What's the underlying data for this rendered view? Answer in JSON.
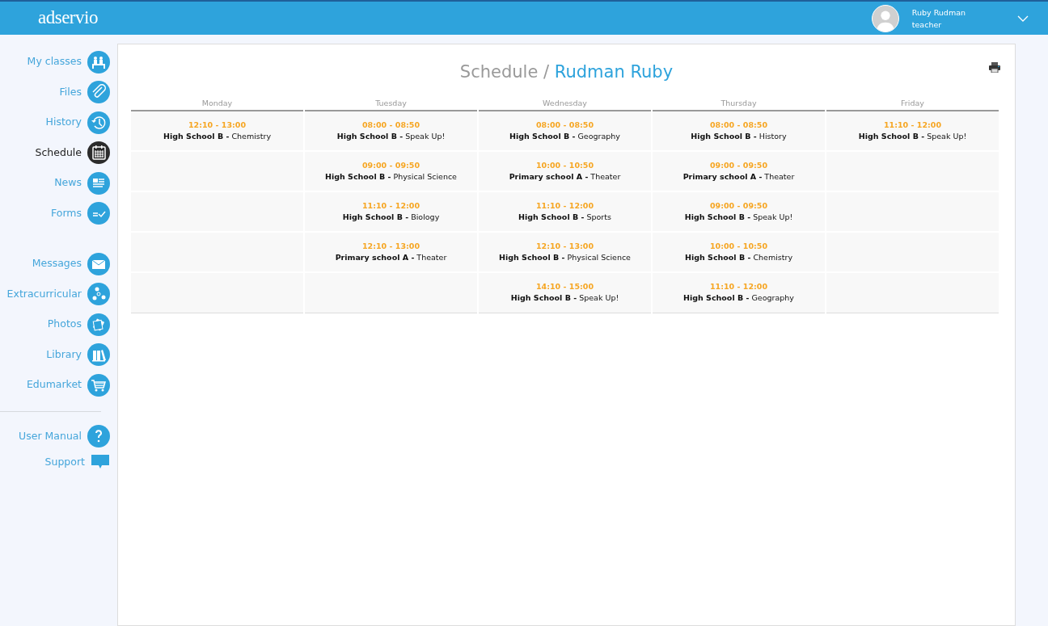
{
  "header": {
    "logo": "adservio",
    "user": {
      "name": "Ruby Rudman",
      "role": "teacher"
    }
  },
  "sidebar": {
    "groups": [
      [
        {
          "label": "My classes",
          "kind": "classes",
          "selected": false
        },
        {
          "label": "Files",
          "kind": "files",
          "selected": false
        },
        {
          "label": "History",
          "kind": "history",
          "selected": false
        },
        {
          "label": "Schedule",
          "kind": "schedule",
          "selected": true
        },
        {
          "label": "News",
          "kind": "news",
          "selected": false
        },
        {
          "label": "Forms",
          "kind": "forms",
          "selected": false
        }
      ],
      [
        {
          "label": "Messages",
          "kind": "messages",
          "selected": false
        },
        {
          "label": "Extracurricular",
          "kind": "extracurricular",
          "selected": false
        },
        {
          "label": "Photos",
          "kind": "photos",
          "selected": false
        },
        {
          "label": "Library",
          "kind": "library",
          "selected": false
        },
        {
          "label": "Edumarket",
          "kind": "market",
          "selected": false
        }
      ],
      [
        {
          "label": "User Manual",
          "kind": "manual",
          "selected": false
        },
        {
          "label": "Support",
          "kind": "support",
          "selected": false
        }
      ]
    ]
  },
  "page": {
    "title": "Schedule / ",
    "subtitle": "Rudman Ruby"
  },
  "schedule": {
    "days": [
      "Monday",
      "Tuesday",
      "Wednesday",
      "Thursday",
      "Friday"
    ],
    "rows": [
      [
        {
          "time": "12:10 - 13:00",
          "text": "**High School B -** Chemistry"
        },
        {
          "time": "08:00 - 08:50",
          "text": "**High School B -** Speak Up!"
        },
        {
          "time": "08:00 - 08:50",
          "text": "**High School B -** Geography"
        },
        {
          "time": "08:00 - 08:50",
          "text": "**High School B -** History"
        },
        {
          "time": "11:10 - 12:00",
          "text": "**High School B -** Speak Up!"
        }
      ],
      [
        null,
        {
          "time": "09:00 - 09:50",
          "text": "**High School B -** Physical Science"
        },
        {
          "time": "10:00 - 10:50",
          "text": "**Primary school A -** Theater"
        },
        {
          "time": "09:00 - 09:50",
          "text": "**Primary school A -** Theater"
        },
        null
      ],
      [
        null,
        {
          "time": "11:10 - 12:00",
          "text": "**High School B -** Biology"
        },
        {
          "time": "11:10 - 12:00",
          "text": "**High School B -** Sports"
        },
        {
          "time": "09:00 - 09:50",
          "text": "**High School B -** Speak Up!"
        },
        null
      ],
      [
        null,
        {
          "time": "12:10 - 13:00",
          "text": "**Primary school A -** Theater"
        },
        {
          "time": "12:10 - 13:00",
          "text": "**High School B -** Physical Science"
        },
        {
          "time": "10:00 - 10:50",
          "text": "**High School B -** Chemistry"
        },
        null
      ],
      [
        null,
        null,
        {
          "time": "14:10 - 15:00",
          "text": "**High School B -** Speak Up!"
        },
        {
          "time": "11:10 - 12:00",
          "text": "**High School B -** Geography"
        },
        null
      ]
    ]
  }
}
